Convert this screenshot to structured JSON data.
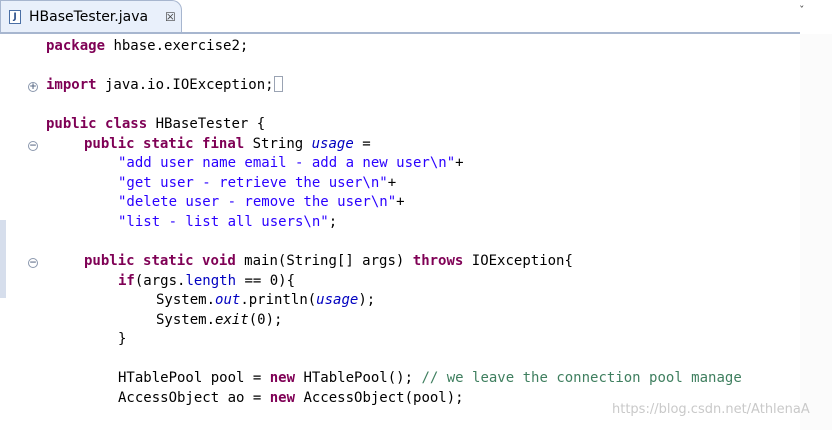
{
  "tab": {
    "title": "HBaseTester.java",
    "close": "☒",
    "menu": "ˇ"
  },
  "code": {
    "l1": [
      "package",
      " hbase.exercise2;"
    ],
    "l2": [
      "import",
      " java.io.IOException;"
    ],
    "l3": [
      "public",
      " ",
      "class",
      " HBaseTester {"
    ],
    "l4": [
      "public",
      " ",
      "static",
      " ",
      "final",
      " String ",
      "usage",
      " ="
    ],
    "l5": [
      "\"add user name email - add a new user\\n\"",
      "+"
    ],
    "l6": [
      "\"get user - retrieve the user\\n\"",
      "+"
    ],
    "l7": [
      "\"delete user - remove the user\\n\"",
      "+"
    ],
    "l8": [
      "\"list - list all users\\n\"",
      ";"
    ],
    "l9": [
      "public",
      " ",
      "static",
      " ",
      "void",
      " main(String[] args) ",
      "throws",
      " IOException{"
    ],
    "l10": [
      "if",
      "(args.",
      "length",
      " == 0){"
    ],
    "l11": [
      "System.",
      "out",
      ".println(",
      "usage",
      ");"
    ],
    "l12": [
      "System.",
      "exit",
      "(0);"
    ],
    "l13": [
      "}"
    ],
    "l14": [
      "HTablePool pool = ",
      "new",
      " HTablePool(); ",
      "// we leave the connection pool manage"
    ],
    "l15": [
      "AccessObject ao = ",
      "new",
      " AccessObject(pool);"
    ]
  },
  "fold_icons": {
    "import": "+",
    "usage": "−",
    "main": "−"
  },
  "watermark": "https://blog.csdn.net/AthlenaA"
}
